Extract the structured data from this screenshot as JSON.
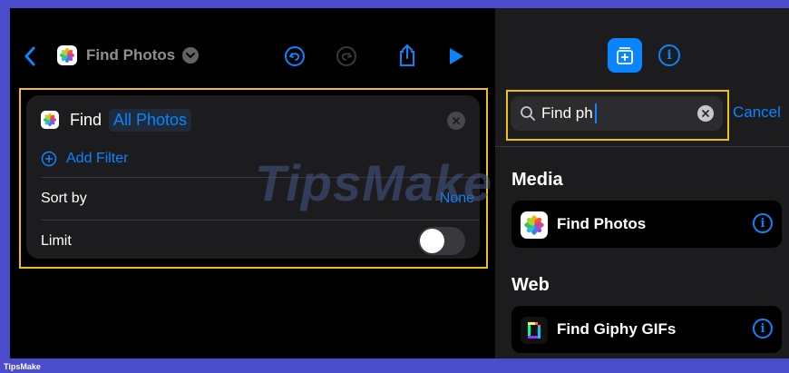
{
  "header": {
    "title": "Find Photos",
    "back_icon": "chevron-left-icon",
    "menu_icon": "chevron-down-circle-icon",
    "undo_icon": "undo-icon",
    "redo_icon": "redo-icon",
    "share_icon": "share-icon",
    "run_icon": "play-icon"
  },
  "action_card": {
    "verb": "Find",
    "param": "All Photos",
    "add_filter": "Add Filter",
    "sort_label": "Sort by",
    "sort_value": "None",
    "limit_label": "Limit",
    "limit_enabled": false
  },
  "search": {
    "value": "Find ph",
    "cancel": "Cancel"
  },
  "sections": [
    {
      "title": "Media",
      "actions": [
        {
          "label": "Find Photos",
          "icon": "photos-icon"
        }
      ]
    },
    {
      "title": "Web",
      "actions": [
        {
          "label": "Find Giphy GIFs",
          "icon": "giphy-icon"
        }
      ]
    }
  ],
  "watermark": "TipsMake",
  "footer_brand": "TipsMake",
  "colors": {
    "accent": "#0a84ff",
    "highlight": "#f2c10f",
    "border": "#4b4ccc"
  }
}
